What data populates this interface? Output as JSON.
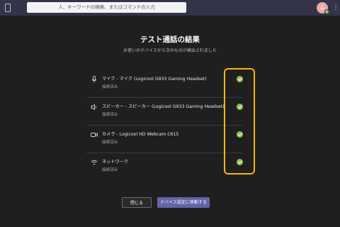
{
  "topbar": {
    "search_placeholder": "人、キーワードの検索、またはコマンドの入力",
    "avatar_initial": "ム",
    "more_label": "⋮"
  },
  "dialog": {
    "title": "テスト通話の結果",
    "subtitle": "お使いのデバイスから次のものが検出されました",
    "rows": [
      {
        "icon": "microphone-icon",
        "name": "マイク - マイク (Logicool G933 Gaming Headset)",
        "status": "接続済み",
        "ok": true
      },
      {
        "icon": "speaker-icon",
        "name": "スピーカー - スピーカー (Logicool G933 Gaming Headset)",
        "status": "接続済み",
        "ok": true
      },
      {
        "icon": "camera-icon",
        "name": "カメラ - Logicool HD Webcam C615",
        "status": "接続済み",
        "ok": true
      },
      {
        "icon": "network-icon",
        "name": "ネットワーク",
        "status": "接続済み",
        "ok": true
      }
    ],
    "close_label": "閉じる",
    "settings_label": "デバイス設定に移動する"
  },
  "colors": {
    "accent": "#6264a7",
    "success": "#92c353",
    "highlight": "#f5b800"
  }
}
